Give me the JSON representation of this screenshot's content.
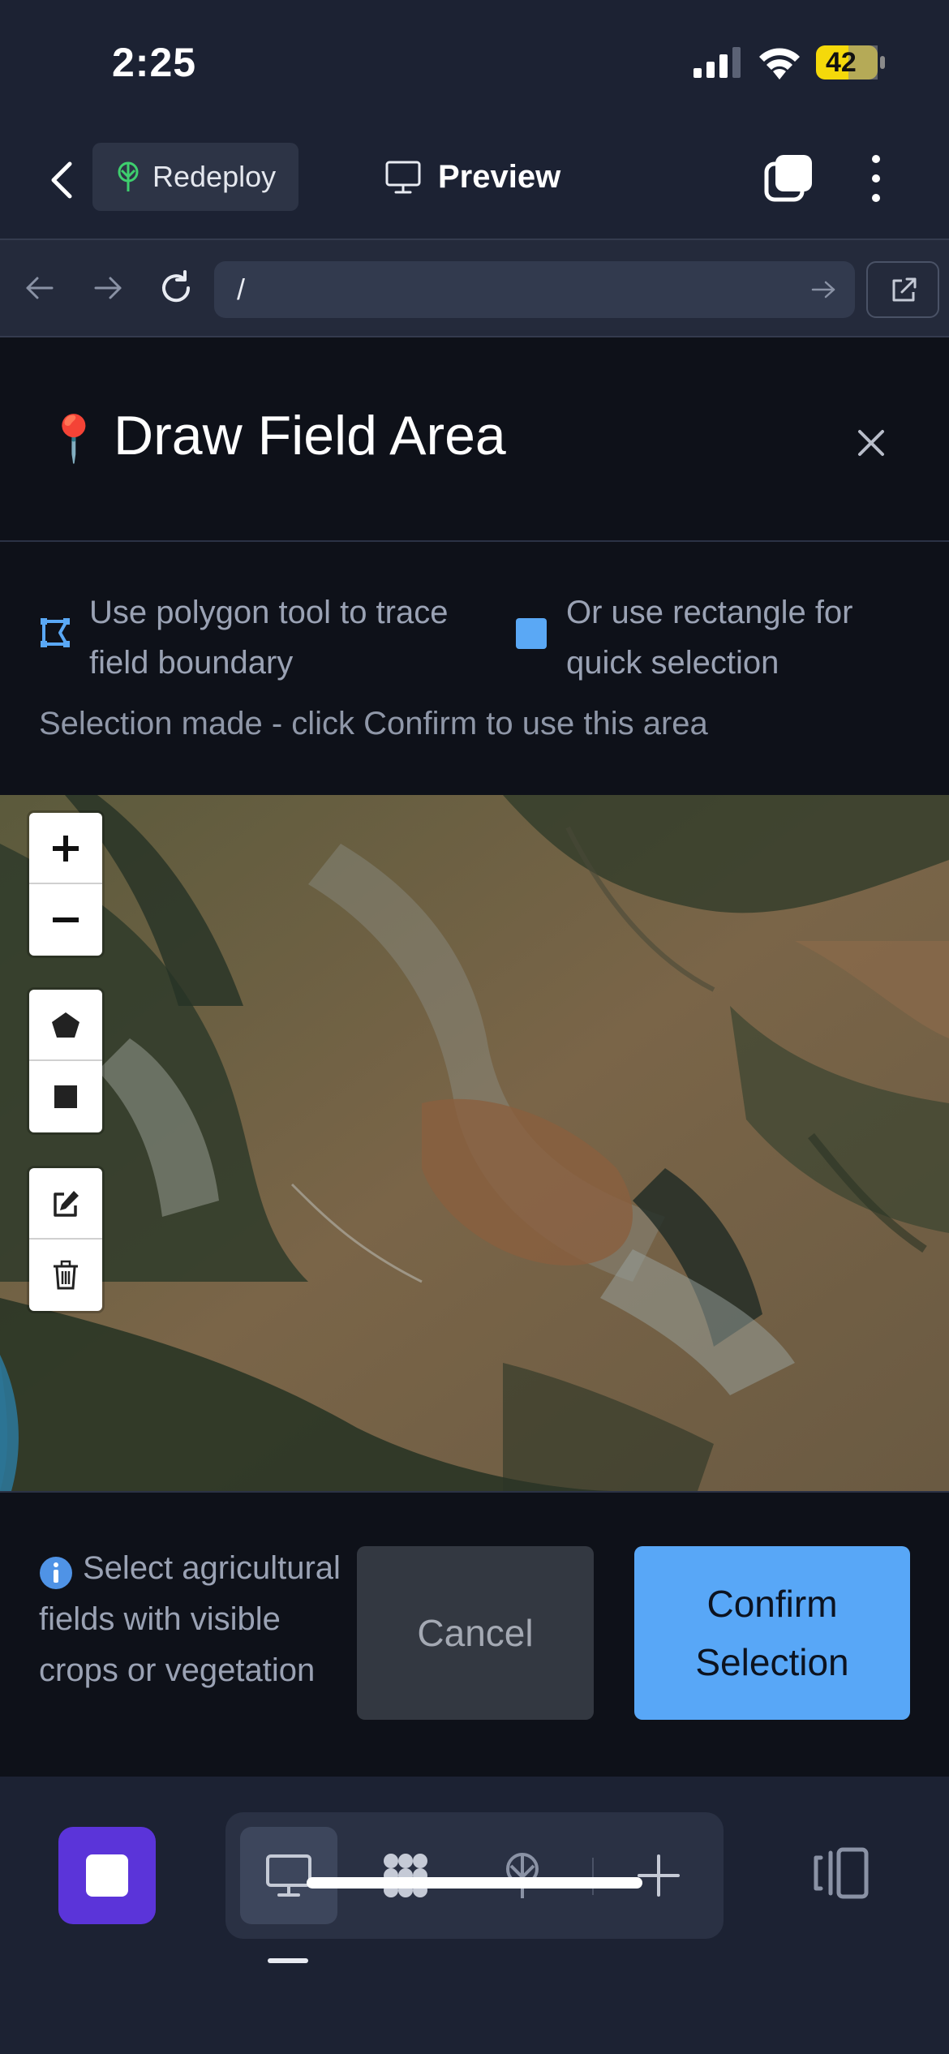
{
  "status_bar": {
    "time": "2:25",
    "battery_level": "42"
  },
  "app_bar": {
    "redeploy_label": "Redeploy",
    "preview_label": "Preview"
  },
  "browser": {
    "url": "/"
  },
  "modal": {
    "pin_icon": "📍",
    "title": "Draw Field Area",
    "instruction_polygon": "Use polygon tool to trace field boundary",
    "instruction_rectangle": "Or use rectangle for quick selection",
    "status": "Selection made - click Confirm to use this area",
    "map_controls": [
      "zoom-in",
      "zoom-out",
      "draw-polygon",
      "draw-rectangle",
      "edit-layers",
      "delete-layers"
    ],
    "hint": "Select agricultural fields with visible crops or vegetation",
    "cancel_label": "Cancel",
    "confirm_label": "Confirm Selection"
  },
  "dock": {
    "segments": [
      "desktop-preview",
      "apps-grid",
      "deploy",
      "add"
    ],
    "active_segment": "desktop-preview"
  },
  "colors": {
    "accent_blue": "#58a7f7",
    "brand_purple": "#5b34d9",
    "battery_yellow": "#f5d90a",
    "background": "#1c2233",
    "modal_bg": "#0e1119"
  }
}
